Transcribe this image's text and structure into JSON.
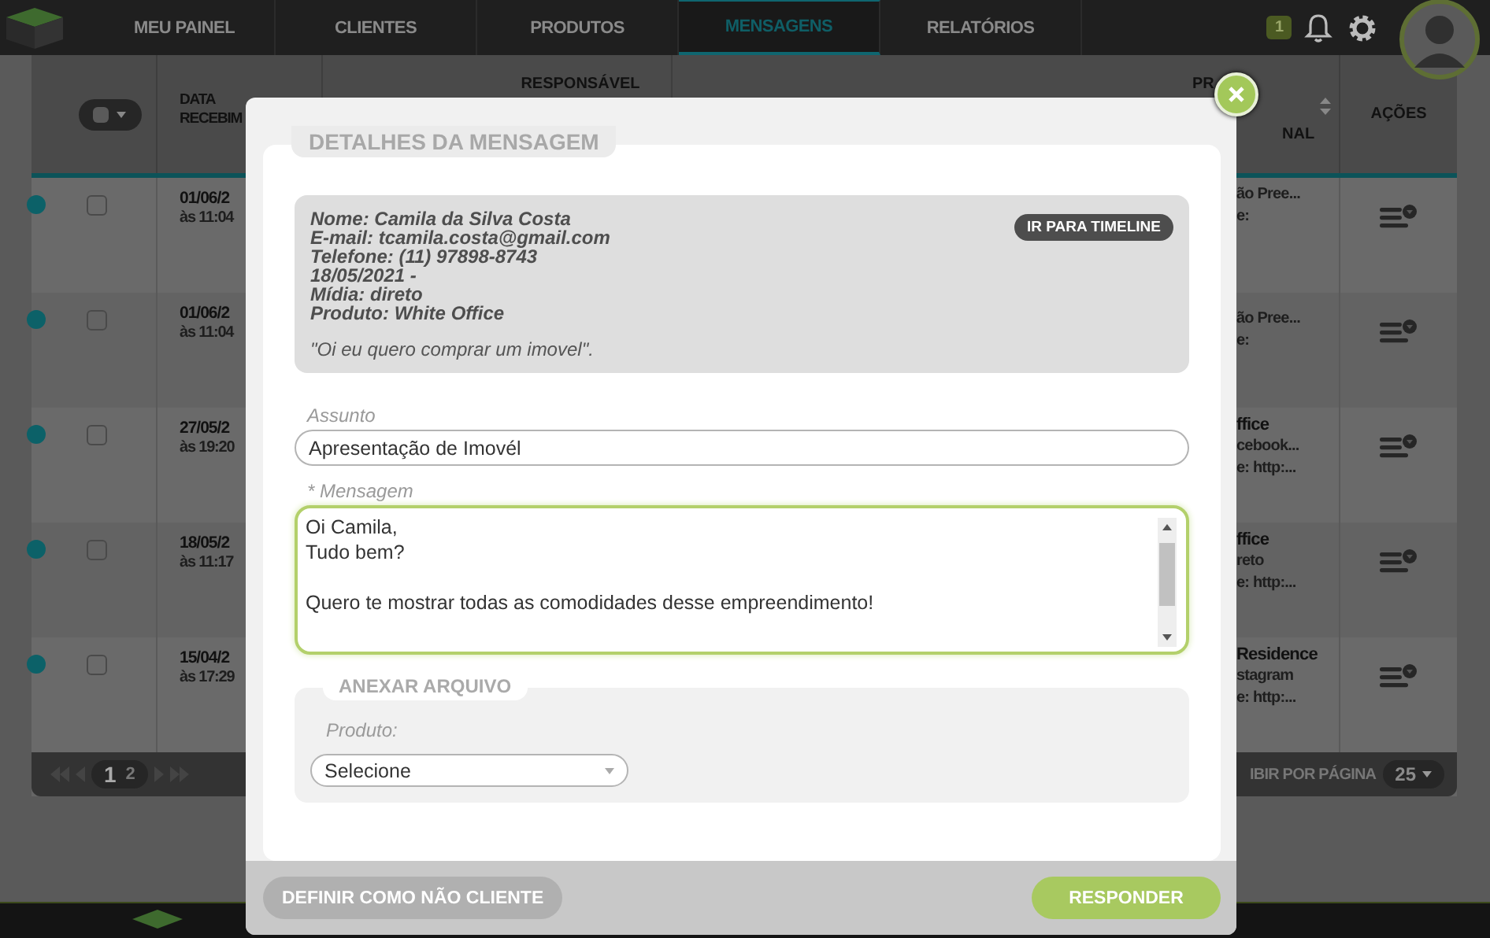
{
  "nav": {
    "tabs": [
      {
        "label": "MEU PAINEL",
        "selected": false
      },
      {
        "label": "CLIENTES",
        "selected": false
      },
      {
        "label": "PRODUTOS",
        "selected": false
      },
      {
        "label": "MENSAGENS",
        "selected": true
      },
      {
        "label": "RELATÓRIOS",
        "selected": false
      }
    ],
    "notification_count": "1"
  },
  "table": {
    "header": {
      "date": [
        "DATA",
        "RECEBIM"
      ],
      "responsible": "RESPONSÁVEL",
      "product_top": "PR",
      "product_bottom": "NAL",
      "actions": "AÇÕES"
    },
    "rows": [
      {
        "unread": true,
        "checked": false,
        "date": "01/06/2",
        "time": "às 11:04",
        "product": [
          "ão Pree...",
          "e:"
        ]
      },
      {
        "unread": true,
        "checked": false,
        "date": "01/06/2",
        "time": "às 11:04",
        "product": [
          "ão Pree...",
          "e:"
        ]
      },
      {
        "unread": true,
        "checked": false,
        "date": "27/05/2",
        "time": "às 19:20",
        "product": [
          "ffice",
          "cebook...",
          "e: http:..."
        ]
      },
      {
        "unread": true,
        "checked": false,
        "date": "18/05/2",
        "time": "às 11:17",
        "product": [
          "ffice",
          "reto",
          "e: http:..."
        ]
      },
      {
        "unread": true,
        "checked": false,
        "date": "15/04/2",
        "time": "às 17:29",
        "product": [
          "Residence",
          "stagram",
          "e: http:..."
        ]
      }
    ],
    "pagination": {
      "pages": [
        {
          "label": "1",
          "selected": true
        },
        {
          "label": "2",
          "selected": false
        }
      ],
      "per_page_label": "IBIR POR PÁGINA",
      "per_page": "25"
    }
  },
  "modal": {
    "title": "DETALHES DA MENSAGEM",
    "contact": {
      "lines": [
        "Nome: Camila da Silva Costa",
        "E-mail: tcamila.costa@gmail.com",
        "Telefone: (11) 97898-8743",
        "18/05/2021 -",
        "Mídia: direto",
        "Produto: White Office"
      ],
      "quote": "\"Oi eu quero comprar um imovel\".",
      "timeline_button": "IR PARA TIMELINE"
    },
    "subject": {
      "label": "Assunto",
      "value": "Apresentação de Imovél"
    },
    "message": {
      "label": "* Mensagem",
      "value": "Oi Camila,\nTudo bem?\n\nQuero te mostrar todas as comodidades desse empreendimento!"
    },
    "attach": {
      "title": "ANEXAR ARQUIVO",
      "product_label": "Produto:",
      "product_value": "Selecione"
    },
    "buttons": {
      "secondary": "DEFINIR COMO NÃO CLIENTE",
      "primary": "RESPONDER"
    }
  }
}
